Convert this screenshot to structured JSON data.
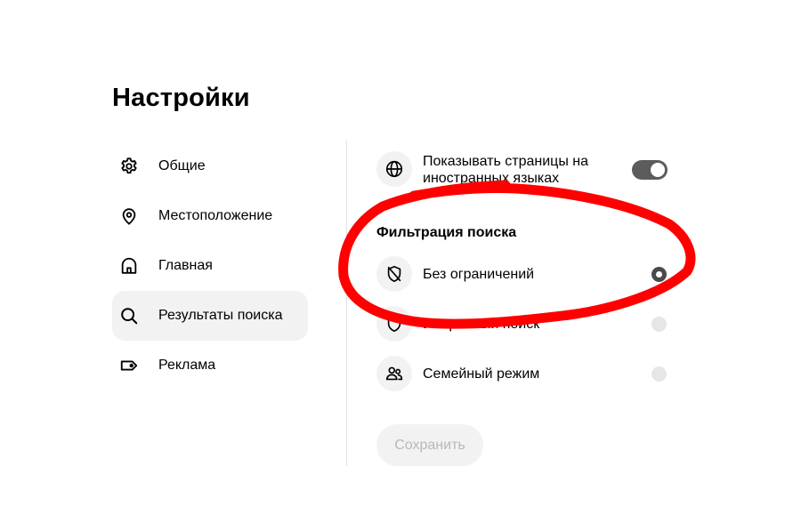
{
  "page": {
    "title": "Настройки"
  },
  "sidebar": {
    "items": [
      {
        "label": "Общие",
        "icon": "gear-icon",
        "active": false
      },
      {
        "label": "Местоположение",
        "icon": "location-pin-icon",
        "active": false
      },
      {
        "label": "Главная",
        "icon": "home-icon",
        "active": false
      },
      {
        "label": "Результаты поиска",
        "icon": "search-icon",
        "active": true
      },
      {
        "label": "Реклама",
        "icon": "ad-tag-icon",
        "active": false
      }
    ]
  },
  "content": {
    "foreign_pages": {
      "label_line1": "Показывать страницы на",
      "label_line2": "иностранных языках",
      "icon": "globe-icon",
      "enabled": true
    },
    "filter": {
      "title": "Фильтрация поиска",
      "options": [
        {
          "label": "Без ограничений",
          "icon": "shield-off-icon",
          "selected": true
        },
        {
          "label": "Умеренный поиск",
          "icon": "shield-icon",
          "selected": false
        },
        {
          "label": "Семейный режим",
          "icon": "family-icon",
          "selected": false
        }
      ]
    },
    "save_label": "Сохранить"
  },
  "colors": {
    "annotation": "#ff0000",
    "toggle_on": "#5c5c5c",
    "active_bg": "#f2f2f2",
    "divider": "#e2e2e2"
  }
}
